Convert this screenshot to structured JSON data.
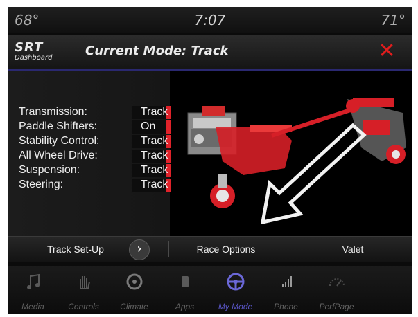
{
  "status_bar": {
    "temp_left": "68°",
    "time": "7:07",
    "temp_right": "71°"
  },
  "header": {
    "logo_text": "SRT",
    "logo_subtext": "Dashboard",
    "title": "Current Mode: Track",
    "close_icon": "close-icon"
  },
  "settings": [
    {
      "label": "Transmission:",
      "value": "Track"
    },
    {
      "label": "Paddle Shifters:",
      "value": "On"
    },
    {
      "label": "Stability Control:",
      "value": "Track"
    },
    {
      "label": "All Wheel Drive:",
      "value": "Track"
    },
    {
      "label": "Suspension:",
      "value": "Track"
    },
    {
      "label": "Steering:",
      "value": "Track"
    }
  ],
  "buttons": {
    "track_setup": "Track Set-Up",
    "race_options": "Race Options",
    "valet": "Valet"
  },
  "nav": [
    {
      "label": "Media",
      "icon": "music-note-icon"
    },
    {
      "label": "Controls",
      "icon": "hand-icon"
    },
    {
      "label": "Climate",
      "icon": "fan-icon"
    },
    {
      "label": "Apps",
      "icon": "apps-icon"
    },
    {
      "label": "My Mode",
      "icon": "steering-wheel-icon"
    },
    {
      "label": "Phone",
      "icon": "phone-signal-icon"
    },
    {
      "label": "PerfPage",
      "icon": "gauge-icon"
    }
  ],
  "colors": {
    "accent_red": "#e0222a",
    "active_nav": "#5a56c8",
    "background": "#0b0b0b"
  }
}
